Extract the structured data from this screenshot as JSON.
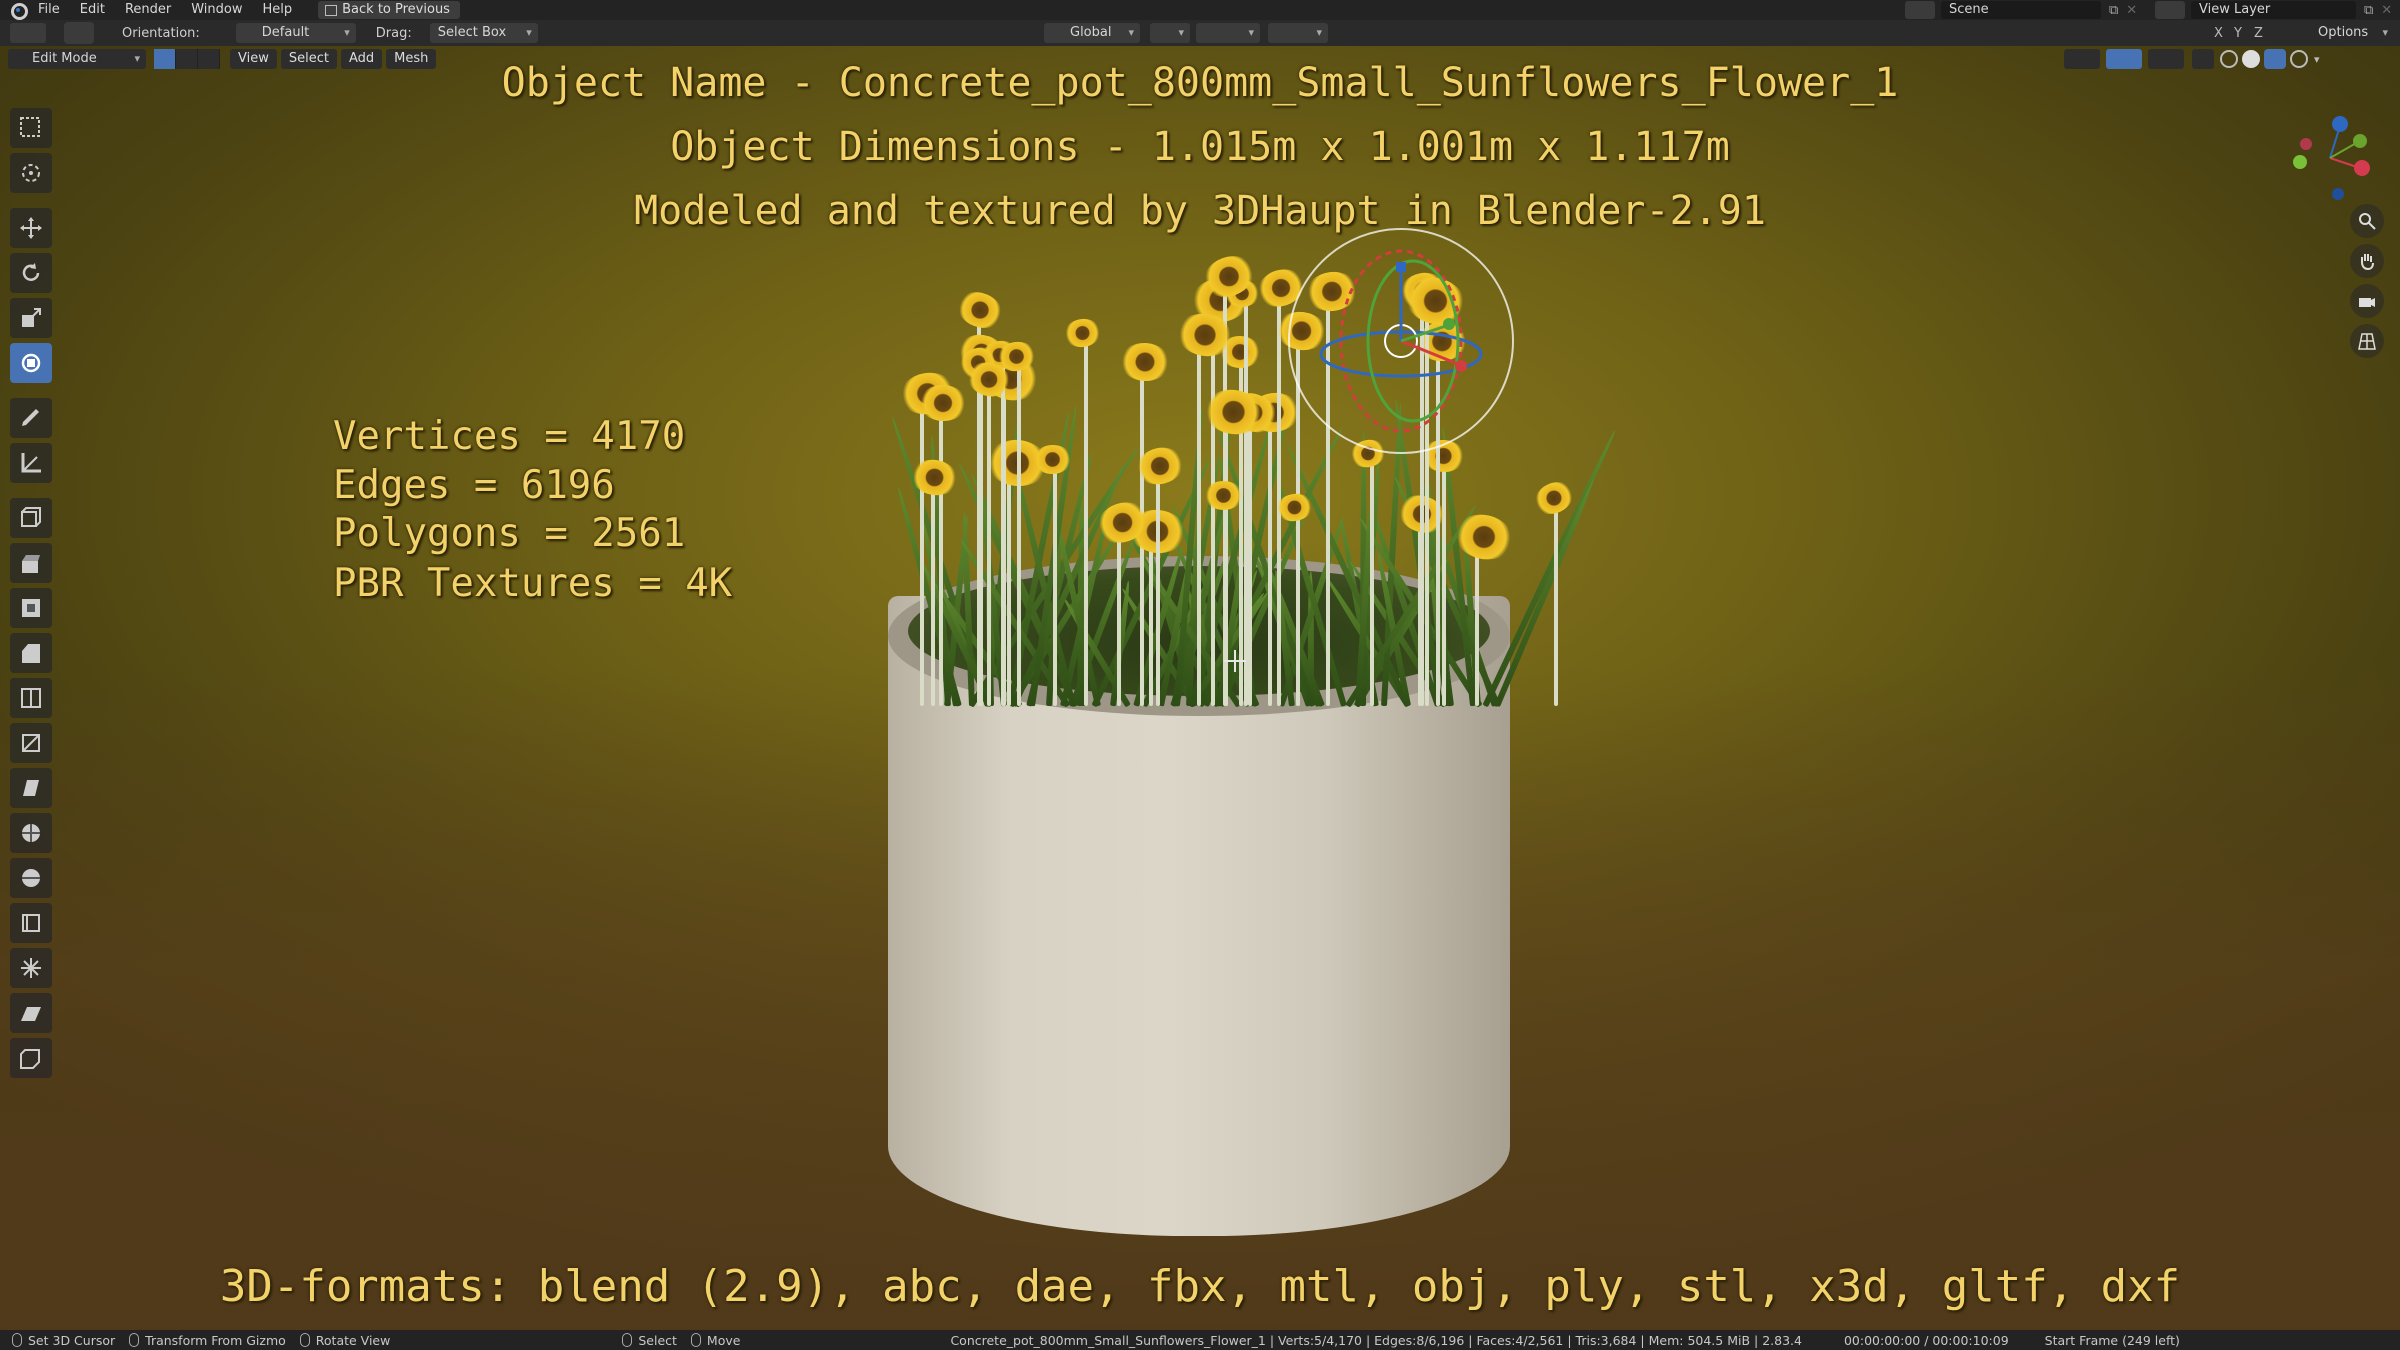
{
  "menu": {
    "items": [
      "File",
      "Edit",
      "Render",
      "Window",
      "Help"
    ],
    "back_button": "Back to Previous",
    "scene": "Scene",
    "view_layer": "View Layer"
  },
  "header": {
    "orientation_label": "Orientation:",
    "orientation_value": "Default",
    "drag_label": "Drag:",
    "drag_value": "Select Box",
    "transform_orientation": "Global",
    "axes": [
      "X",
      "Y",
      "Z"
    ],
    "options": "Options"
  },
  "viewport_header": {
    "mode": "Edit Mode",
    "menu": [
      "View",
      "Select",
      "Add",
      "Mesh"
    ]
  },
  "overlay": {
    "object_name": "Object Name - Concrete_pot_800mm_Small_Sunflowers_Flower_1",
    "dimensions": "Object Dimensions -  1.015m x 1.001m x 1.117m",
    "modeled_by": "Modeled and textured by 3DHaupt in Blender-2.91",
    "stats": [
      "Vertices = 4170",
      "Edges = 6196",
      "Polygons = 2561",
      "PBR Textures = 4K"
    ],
    "formats": "3D-formats: blend (2.9), abc, dae, fbx, mtl, obj, ply, stl, x3d, gltf, dxf"
  },
  "toolbar_tools": [
    "select-box",
    "cursor",
    "move",
    "rotate",
    "scale",
    "transform",
    "annotate",
    "measure",
    "add-cube",
    "extrude",
    "inset",
    "bevel",
    "loop-cut",
    "knife",
    "poly-build",
    "spin",
    "smooth",
    "edge-slide",
    "shrink-fatten",
    "shear",
    "rip"
  ],
  "statusbar": {
    "set_cursor": "Set 3D Cursor",
    "transform_gizmo": "Transform From Gizmo",
    "rotate_view": "Rotate View",
    "select": "Select",
    "move": "Move",
    "stats": "Concrete_pot_800mm_Small_Sunflowers_Flower_1 | Verts:5/4,170 | Edges:8/6,196 | Faces:4/2,561 | Tris:3,684 | Mem: 504.5 MiB | 2.83.4",
    "time": "00:00:00:00 / 00:00:10:09",
    "start_frame": "Start Frame (249 left)"
  },
  "colors": {
    "accent": "#4772b3",
    "overlay_text": "#f3d26a"
  }
}
